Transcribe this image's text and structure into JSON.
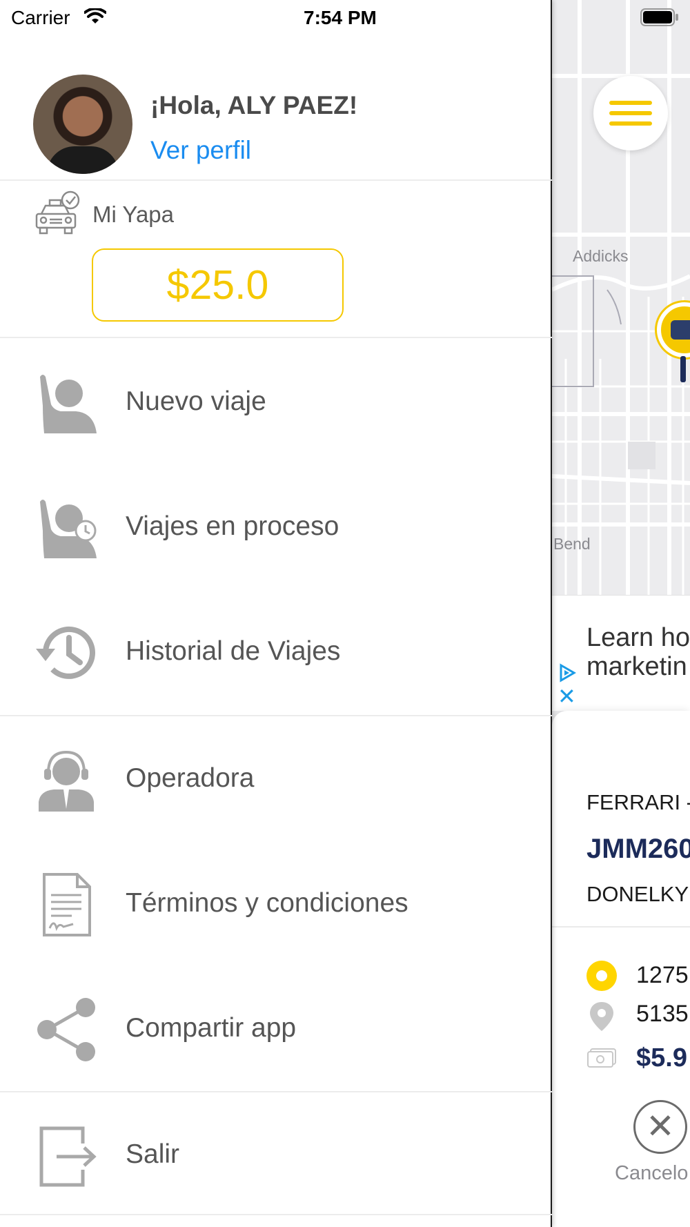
{
  "status_bar": {
    "carrier": "Carrier",
    "time": "7:54 PM"
  },
  "profile": {
    "greeting": "¡Hola, ALY PAEZ!",
    "link": "Ver perfil"
  },
  "yapa": {
    "label": "Mi Yapa",
    "balance": "$25.0"
  },
  "menu": {
    "nuevo_viaje": "Nuevo viaje",
    "viajes_proceso": "Viajes en proceso",
    "historial": "Historial de Viajes",
    "operadora": "Operadora",
    "terminos": "Términos y condiciones",
    "compartir": "Compartir app",
    "salir": "Salir"
  },
  "map": {
    "label_1": "Addicks",
    "label_2": "Bend"
  },
  "ad": {
    "line_1": "Learn ho",
    "line_2": "marketin",
    "close": "✕"
  },
  "trip": {
    "car_model": "FERRARI -",
    "plate": "JMM260",
    "driver": "DONELKY",
    "origin": "1275",
    "destination": "5135",
    "price": "$5.9",
    "cancel_label": "Cancelo",
    "cancel_symbol": "✕"
  },
  "colors": {
    "accent_yellow": "#f5c800",
    "link_blue": "#1a8cf0",
    "navy": "#1c2b5a",
    "menu_text": "#555555",
    "icon_gray": "#a9a9a9"
  },
  "icons": [
    "wifi-icon",
    "battery-icon",
    "hamburger-icon",
    "taxi-marker-icon",
    "taxi-check-icon",
    "raised-hand-icon",
    "raised-hand-clock-icon",
    "history-icon",
    "headset-operator-icon",
    "document-signature-icon",
    "share-icon",
    "logout-icon",
    "origin-dot-icon",
    "location-pin-icon",
    "cash-icon",
    "close-icon"
  ]
}
